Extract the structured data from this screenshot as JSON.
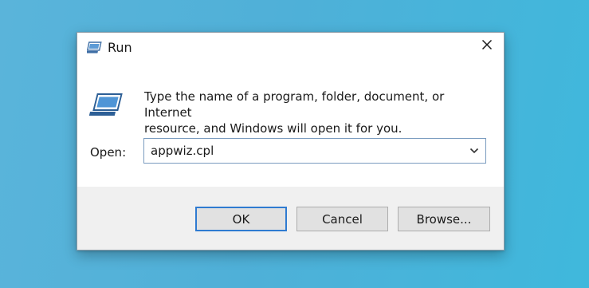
{
  "window": {
    "title": "Run",
    "close_icon": "close-icon",
    "title_icon": "run-icon"
  },
  "body": {
    "icon": "run-icon",
    "message_line1": "Type the name of a program, folder, document, or Internet",
    "message_line2": "resource, and Windows will open it for you.",
    "open_label": "Open:",
    "open_value": "appwiz.cpl",
    "dropdown_icon": "chevron-down-icon"
  },
  "buttons": {
    "ok": "OK",
    "cancel": "Cancel",
    "browse": "Browse..."
  },
  "colors": {
    "accent": "#2f7bd1",
    "footer_bg": "#f0f0f0",
    "desktop_bg": "#4fb0d8"
  }
}
